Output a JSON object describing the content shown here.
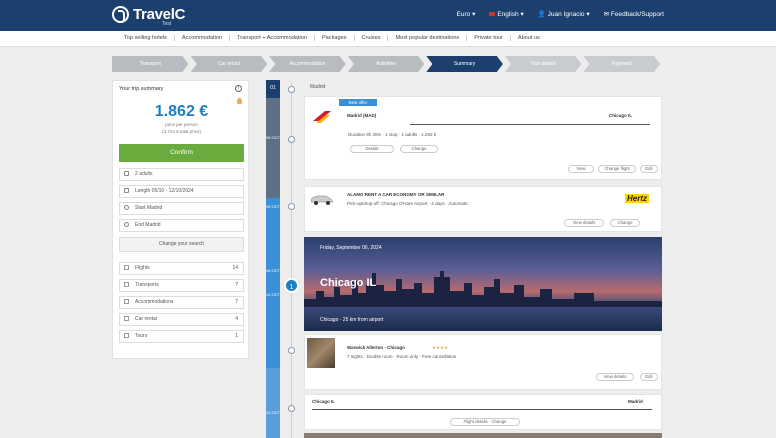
{
  "header": {
    "logo_text": "TravelC",
    "logo_sub": "Test",
    "menu": [
      "Euro",
      "English",
      "Juan Ignacio",
      "Feedback/Support"
    ]
  },
  "nav": {
    "items": [
      "Top selling hotels",
      "Accommodation",
      "Transport + Accommodation",
      "Packages",
      "Cruises",
      "Most popular destinations",
      "Private tour",
      "About us"
    ]
  },
  "steps": [
    "Transport",
    "Car rental",
    "Accommodation",
    "Activities",
    "Summary",
    "Your details",
    "Payment"
  ],
  "summary": {
    "title": "Your trip summary",
    "price": "1.862 €",
    "price_sub1": "price per person",
    "price_sub2": "(3.724 € total price)",
    "confirm": "Confirm",
    "fields": [
      "2 adults",
      "Length 05/10 - 12/10/2024",
      "Start Madrid",
      "End Madrid"
    ],
    "change": "Change your search",
    "categories": [
      {
        "label": "Flights",
        "count": "14"
      },
      {
        "label": "Transports",
        "count": "7"
      },
      {
        "label": "Accommodations",
        "count": "7"
      },
      {
        "label": "Car rental",
        "count": "4"
      },
      {
        "label": "Tours",
        "count": "1"
      }
    ]
  },
  "timeline": {
    "top_label": "01",
    "segments": [
      "05 OCT",
      "05 OCT",
      "06 OCT",
      "12 OCT",
      "12 OCT"
    ],
    "big_marker": "1"
  },
  "flight": {
    "origin_city": "Madrid",
    "tag": "Best offer",
    "from": "Madrid (MAD)",
    "to": "Chicago IL",
    "details": "Duration 9h 20m · 1 stop · 1 adults · 1.262 €",
    "pills": [
      "Details",
      "Change"
    ],
    "actions": [
      "View",
      "Change flight",
      "Edit"
    ]
  },
  "car": {
    "title": "ALAMO RENT A CAR ECONOMY OR SIMILAR",
    "details": "Pick-up/drop-off: Chicago O'Hare Airport · 4 days · Automatic",
    "brand": "Hertz",
    "actions": [
      "View details",
      "Change"
    ]
  },
  "destination": {
    "date": "Friday, September 06, 2024",
    "title": "Chicago IL",
    "sub": "Chicago · 25 km from airport"
  },
  "hotel": {
    "title": "Warwick Allerton - Chicago",
    "stars": "★★★★",
    "details": "7 nights · Double room · Room only · Free cancellation",
    "actions": [
      "View details",
      "Edit"
    ]
  },
  "return_flight": {
    "from": "Chicago IL",
    "to": "Madrid",
    "link": "Flight details · Change"
  }
}
